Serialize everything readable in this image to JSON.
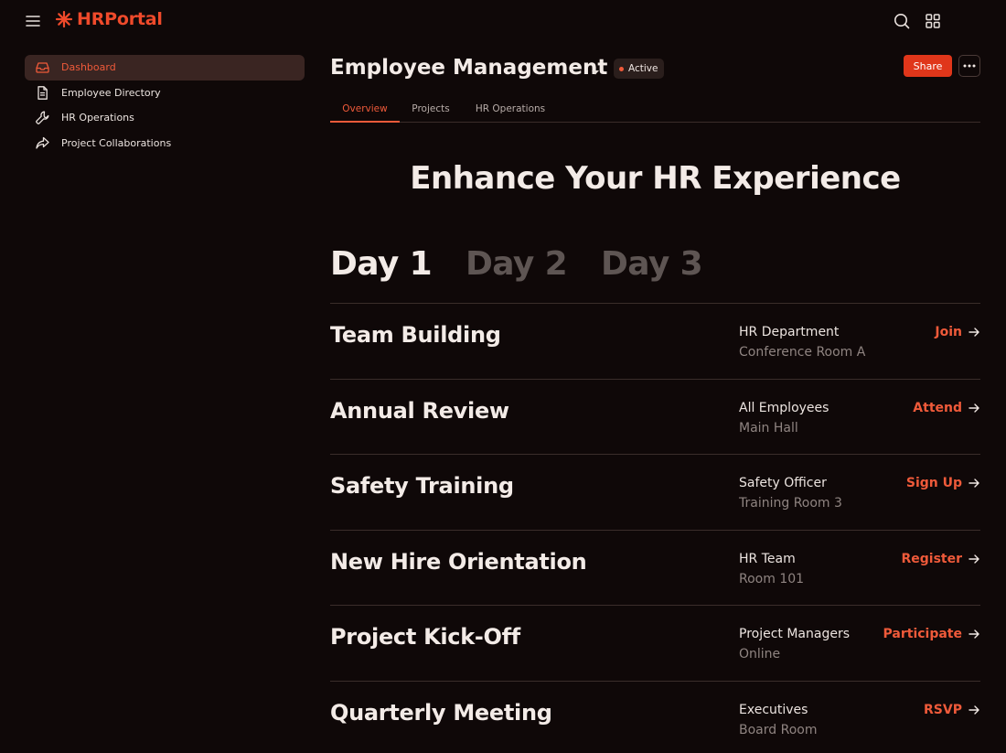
{
  "app": {
    "name": "HRPortal",
    "brand_color": "#ef4a2b"
  },
  "sidebar": {
    "items": [
      {
        "label": "Dashboard",
        "icon": "inbox-tray-icon",
        "active": true
      },
      {
        "label": "Employee Directory",
        "icon": "document-icon",
        "active": false
      },
      {
        "label": "HR Operations",
        "icon": "wrench-icon",
        "active": false
      },
      {
        "label": "Project Collaborations",
        "icon": "share-arrow-icon",
        "active": false
      }
    ]
  },
  "header": {
    "title": "Employee Management",
    "status": "Active",
    "share_label": "Share"
  },
  "tabs": [
    {
      "label": "Overview",
      "active": true
    },
    {
      "label": "Projects",
      "active": false
    },
    {
      "label": "HR Operations",
      "active": false
    }
  ],
  "hero": {
    "title": "Enhance Your HR Experience"
  },
  "days": [
    {
      "label": "Day 1",
      "active": true
    },
    {
      "label": "Day 2",
      "active": false
    },
    {
      "label": "Day 3",
      "active": false
    }
  ],
  "sessions": [
    {
      "title": "Team Building",
      "host": "HR Department",
      "room": "Conference Room A",
      "action": "Join"
    },
    {
      "title": "Annual Review",
      "host": "All Employees",
      "room": "Main Hall",
      "action": "Attend"
    },
    {
      "title": "Safety Training",
      "host": "Safety Officer",
      "room": "Training Room 3",
      "action": "Sign Up"
    },
    {
      "title": "New Hire Orientation",
      "host": "HR Team",
      "room": "Room 101",
      "action": "Register"
    },
    {
      "title": "Project Kick-Off",
      "host": "Project Managers",
      "room": "Online",
      "action": "Participate"
    },
    {
      "title": "Quarterly Meeting",
      "host": "Executives",
      "room": "Board Room",
      "action": "RSVP"
    }
  ]
}
